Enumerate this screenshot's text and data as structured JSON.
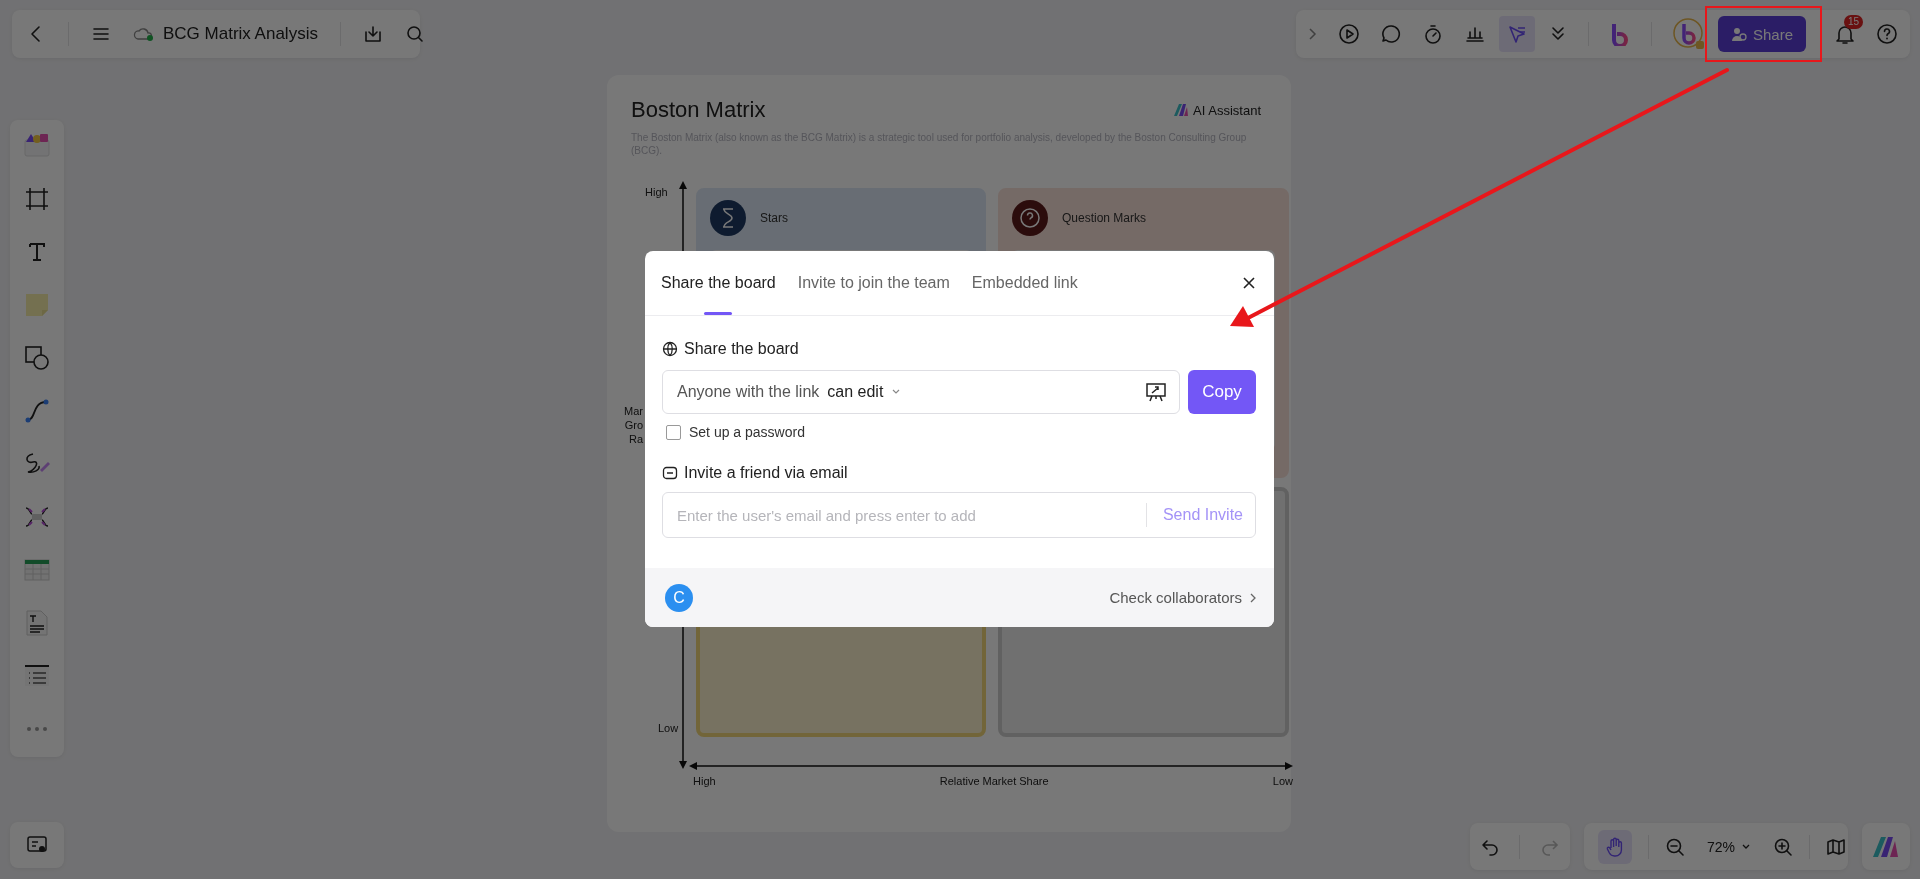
{
  "top_left_bar": {
    "title": "BCG Matrix Analysis"
  },
  "top_right_bar": {
    "share_button": "Share",
    "notification_count": "15"
  },
  "board": {
    "title": "Boston Matrix",
    "ai_assistant": "AI Assistant",
    "description": "The Boston Matrix (also known as the BCG Matrix) is a strategic tool used for portfolio analysis, developed by the Boston Consulting Group (BCG).",
    "y_axis": {
      "high": "High",
      "low": "Low",
      "label_fragments": [
        "Mar",
        "Gro",
        "Ra"
      ]
    },
    "x_axis": {
      "high": "High",
      "label": "Relative Market Share",
      "low": "Low"
    },
    "quadrants": [
      {
        "kind": "stars",
        "title": "Stars"
      },
      {
        "kind": "question",
        "title": "Question Marks"
      },
      {
        "kind": "cash"
      },
      {
        "kind": "dog"
      }
    ]
  },
  "dialog": {
    "tabs": [
      {
        "label": "Share the board",
        "selected": true
      },
      {
        "label": "Invite to join the team",
        "selected": false
      },
      {
        "label": "Embedded link",
        "selected": false
      }
    ],
    "section_title": "Share the board",
    "link_access": "Anyone with the link",
    "permission": "can edit",
    "copy_button": "Copy",
    "password_option": {
      "label": "Set up a password",
      "checked": false
    },
    "invite_title": "Invite a friend via email",
    "email_field": {
      "placeholder": "Enter the user's email and press enter to add"
    },
    "send_button": {
      "label": "Send Invite",
      "disabled": true
    },
    "collaborators": [
      {
        "initial": "C",
        "color": "#2b8ff0"
      }
    ],
    "check_collaborators": "Check collaborators"
  },
  "bottom_bar": {
    "zoom": "72%",
    "hand_tool_selected": true
  }
}
